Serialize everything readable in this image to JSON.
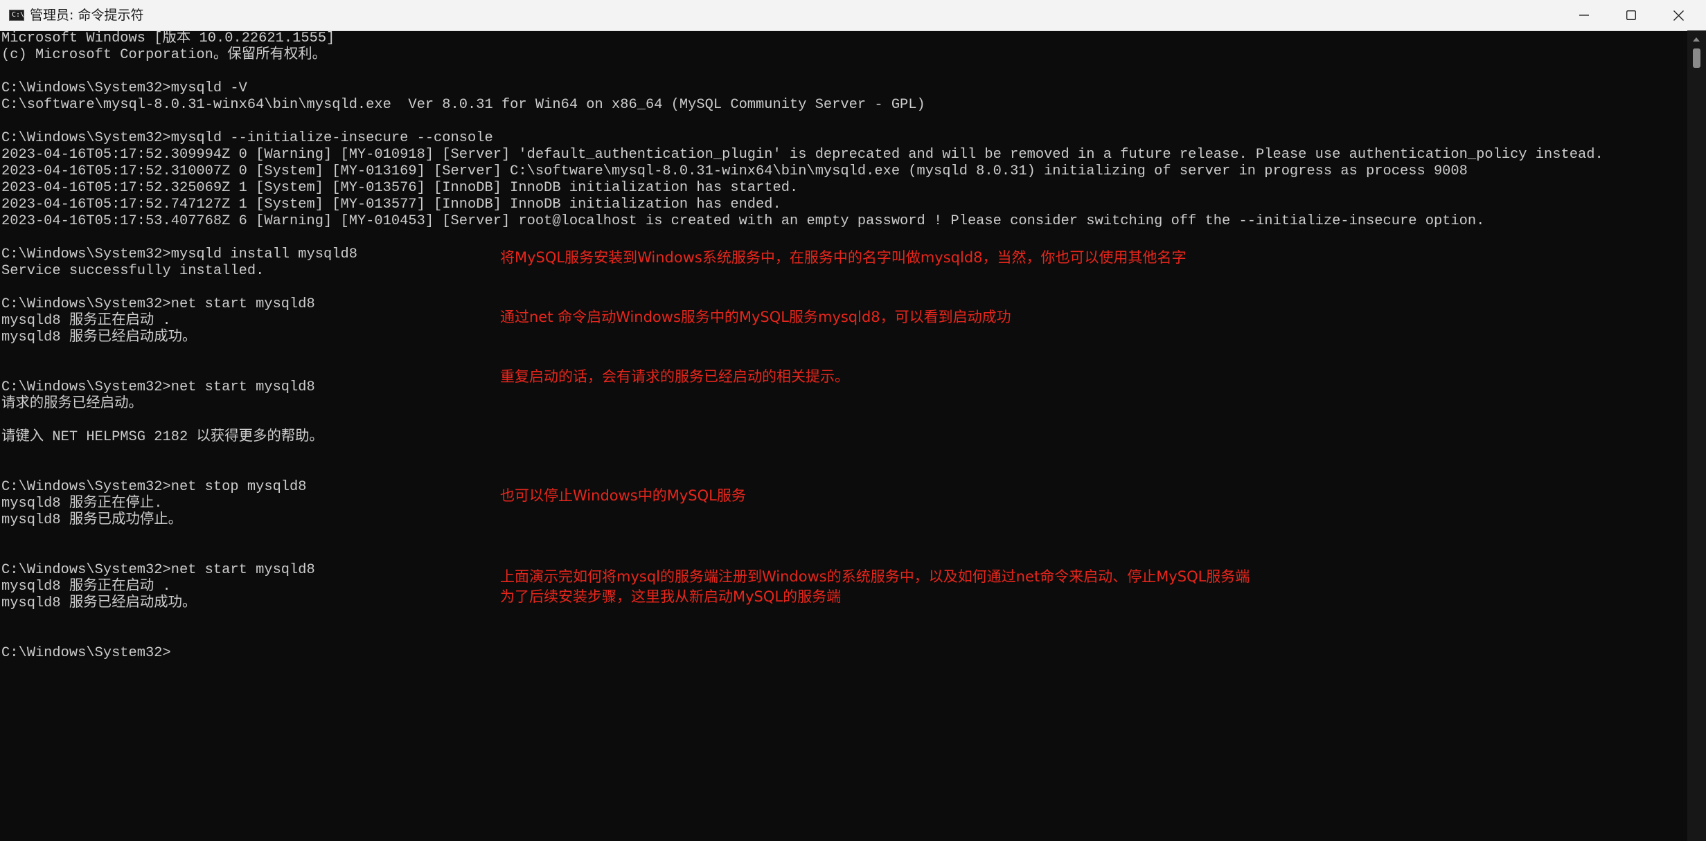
{
  "window": {
    "title": "管理员: 命令提示符",
    "icon": "cmd-prompt-icon",
    "controls": {
      "minimize": "minimize-icon",
      "maximize": "maximize-icon",
      "close": "close-icon"
    }
  },
  "terminal": {
    "lines": [
      "Microsoft Windows [版本 10.0.22621.1555]",
      "(c) Microsoft Corporation。保留所有权利。",
      "",
      "C:\\Windows\\System32>mysqld -V",
      "C:\\software\\mysql-8.0.31-winx64\\bin\\mysqld.exe  Ver 8.0.31 for Win64 on x86_64 (MySQL Community Server - GPL)",
      "",
      "C:\\Windows\\System32>mysqld --initialize-insecure --console",
      "2023-04-16T05:17:52.309994Z 0 [Warning] [MY-010918] [Server] 'default_authentication_plugin' is deprecated and will be removed in a future release. Please use authentication_policy instead.",
      "2023-04-16T05:17:52.310007Z 0 [System] [MY-013169] [Server] C:\\software\\mysql-8.0.31-winx64\\bin\\mysqld.exe (mysqld 8.0.31) initializing of server in progress as process 9008",
      "2023-04-16T05:17:52.325069Z 1 [System] [MY-013576] [InnoDB] InnoDB initialization has started.",
      "2023-04-16T05:17:52.747127Z 1 [System] [MY-013577] [InnoDB] InnoDB initialization has ended.",
      "2023-04-16T05:17:53.407768Z 6 [Warning] [MY-010453] [Server] root@localhost is created with an empty password ! Please consider switching off the --initialize-insecure option.",
      "",
      "C:\\Windows\\System32>mysqld install mysqld8",
      "Service successfully installed.",
      "",
      "C:\\Windows\\System32>net start mysqld8",
      "mysqld8 服务正在启动 .",
      "mysqld8 服务已经启动成功。",
      "",
      "",
      "C:\\Windows\\System32>net start mysqld8",
      "请求的服务已经启动。",
      "",
      "请键入 NET HELPMSG 2182 以获得更多的帮助。",
      "",
      "",
      "C:\\Windows\\System32>net stop mysqld8",
      "mysqld8 服务正在停止.",
      "mysqld8 服务已成功停止。",
      "",
      "",
      "C:\\Windows\\System32>net start mysqld8",
      "mysqld8 服务正在启动 .",
      "mysqld8 服务已经启动成功。",
      "",
      "",
      "C:\\Windows\\System32>"
    ],
    "annotations": [
      "将MySQL服务安装到Windows系统服务中，在服务中的名字叫做mysqld8，当然，你也可以使用其他名字",
      "通过net 命令启动Windows服务中的MySQL服务mysqld8，可以看到启动成功",
      "重复启动的话，会有请求的服务已经启动的相关提示。",
      "也可以停止Windows中的MySQL服务",
      "上面演示完如何将mysql的服务端注册到Windows的系统服务中，以及如何通过net命令来启动、停止MySQL服务端",
      "为了后续安装步骤，这里我从新启动MySQL的服务端"
    ],
    "colors": {
      "background": "#0c0c0c",
      "text": "#cccccc",
      "annotation": "#e8261c"
    }
  }
}
